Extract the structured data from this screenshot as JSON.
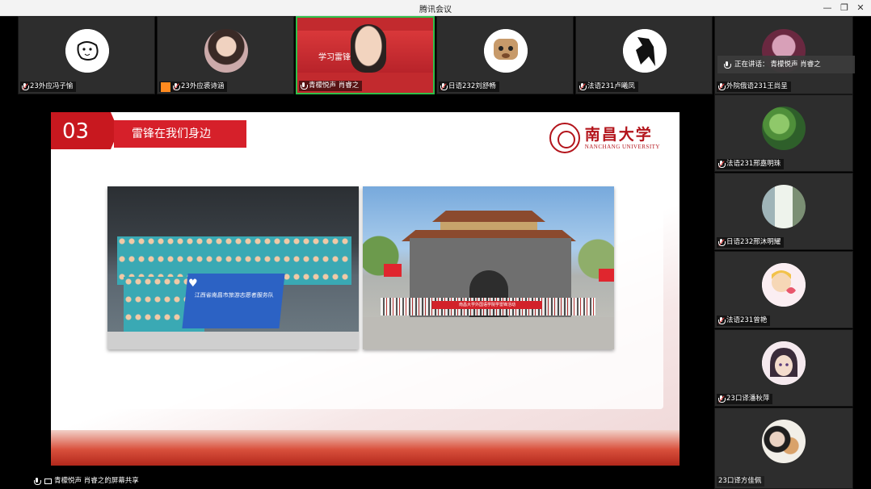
{
  "window": {
    "title": "腾讯会议"
  },
  "top_row": [
    {
      "name": "23外应冯子愉",
      "muted": true,
      "avatar": "dog-sketch"
    },
    {
      "name": "23外应裘诗涵",
      "muted": true,
      "avatar": "girl-photo",
      "host_badge": true
    },
    {
      "name": "青檬悦声 肖睿之",
      "muted": false,
      "avatar": "video",
      "active": true,
      "video_text": "学习雷锋 时代先锋"
    },
    {
      "name": "日语232刘舒畅",
      "muted": true,
      "avatar": "cartoon-dog"
    },
    {
      "name": "法语231卢曦凤",
      "muted": true,
      "avatar": "anime-figure"
    },
    {
      "name": "外院俄语231王尚呈",
      "muted": true,
      "avatar": "portrait"
    }
  ],
  "right_column": [
    {
      "name": "法语231邢嘉明珠",
      "muted": true,
      "avatar": "green-plant"
    },
    {
      "name": "日语232邢沐明耀",
      "muted": true,
      "avatar": "window-light"
    },
    {
      "name": "法语231曾艳",
      "muted": true,
      "avatar": "cartoon-girl"
    },
    {
      "name": "23口译潘秋萍",
      "muted": true,
      "avatar": "anime-girl"
    },
    {
      "name": "23口译方佳佩",
      "muted": true,
      "avatar": "person-cat"
    }
  ],
  "speaking_indicator": {
    "label": "正在讲话：",
    "name": "青檬悦声 肖睿之"
  },
  "slide": {
    "number": "03",
    "title": "雷锋在我们身边",
    "university_zh": "南昌大学",
    "university_en": "NANCHANG UNIVERSITY",
    "photo1_banner": "江西省南昌市旅游志愿者服务队",
    "photo2_banner": "南昌大学外国语学院学雷锋活动"
  },
  "status_bar": {
    "text": "青檬悦声 肖睿之的屏幕共享"
  },
  "colors": {
    "accent_red": "#c8181f",
    "active_border": "#2fbf4a"
  }
}
